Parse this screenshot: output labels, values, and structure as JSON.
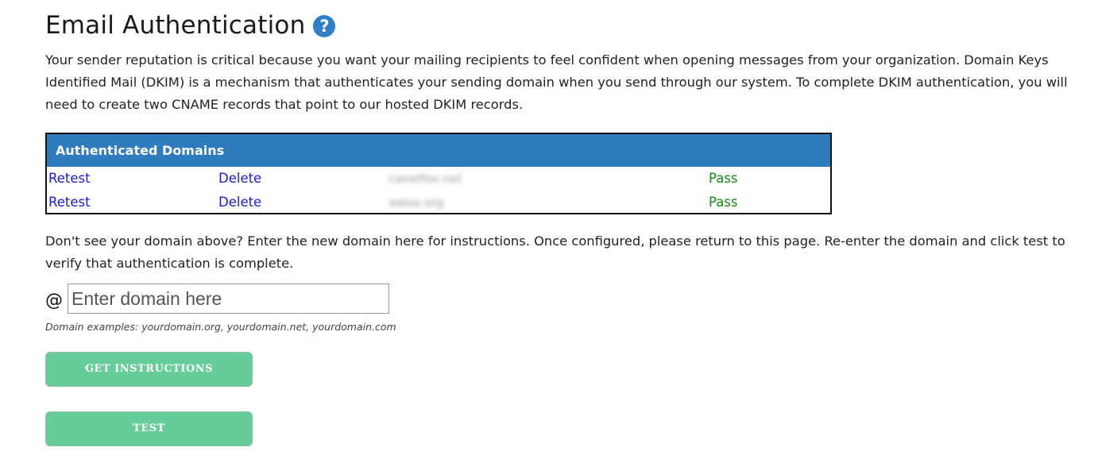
{
  "header": {
    "title": "Email Authentication",
    "help_icon": "question-circle-icon",
    "help_glyph": "?"
  },
  "intro_text": "Your sender reputation is critical because you want your mailing recipients to feel confident when opening messages from your organization. Domain Keys Identified Mail (DKIM) is a mechanism that authenticates your sending domain when you send through our system. To complete DKIM authentication, you will need to create two CNAME records that point to our hosted DKIM records.",
  "table": {
    "header": "Authenticated Domains",
    "rows": [
      {
        "retest": "Retest",
        "delete": "Delete",
        "domain": "canelfox.net",
        "status": "Pass"
      },
      {
        "retest": "Retest",
        "delete": "Delete",
        "domain": "awea.org",
        "status": "Pass"
      }
    ]
  },
  "note_text": "Don't see your domain above? Enter the new domain here for instructions. Once configured, please return to this page. Re-enter the domain and click test to verify that authentication is complete.",
  "domain_form": {
    "at_symbol": "@",
    "placeholder": "Enter domain here",
    "value": "",
    "examples": "Domain examples: yourdomain.org, yourdomain.net, yourdomain.com"
  },
  "buttons": {
    "get_instructions": "GET INSTRUCTIONS",
    "test": "TEST"
  },
  "colors": {
    "table_header": "#2e7bbd",
    "link": "#1a1ad2",
    "pass": "#138a13",
    "button": "#66cc99",
    "help_icon": "#2f7fc6"
  }
}
